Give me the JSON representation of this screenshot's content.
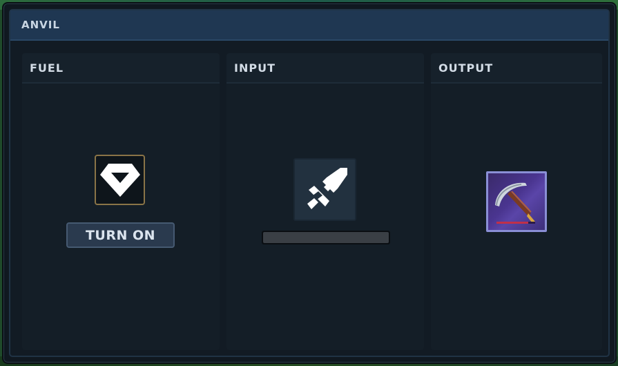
{
  "window": {
    "title": "ANVIL"
  },
  "panels": {
    "fuel": {
      "title": "FUEL",
      "button_label": "TURN ON",
      "slot_icon": "diamond-gem-icon"
    },
    "input": {
      "title": "INPUT",
      "slot_icon": "sword-icon",
      "progress": 0.0
    },
    "output": {
      "title": "OUTPUT",
      "slot_icon": "pickaxe-icon",
      "item_durability": 0.82
    }
  },
  "colors": {
    "titlebar": "#1f3752",
    "fuel_slot_border": "#8a7447",
    "output_slot_border": "#8a8fd6",
    "output_slot_bg": "#4a3590"
  }
}
